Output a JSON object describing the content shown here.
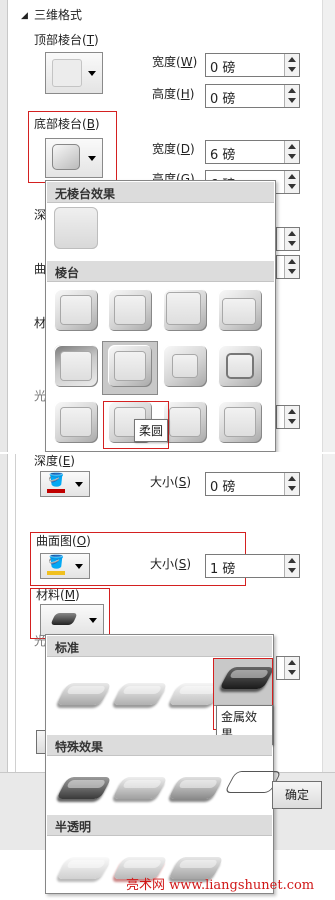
{
  "top": {
    "section_title": "三维格式",
    "bevel_top": {
      "label": "顶部棱台(",
      "key": "T",
      "close": ")"
    },
    "bevel_bottom": {
      "label": "底部棱台(",
      "key": "B",
      "close": ")"
    },
    "width1": {
      "label": "宽度(",
      "key": "W",
      "close": ")",
      "value": "0 磅"
    },
    "height1": {
      "label": "高度(",
      "key": "H",
      "close": ")",
      "value": "0 磅"
    },
    "width2": {
      "label": "宽度(",
      "key": "D",
      "close": ")",
      "value": "6 磅"
    },
    "height2": {
      "label": "高度(",
      "key": "G",
      "close": ")",
      "value": "6 磅"
    },
    "depth_partial": "深",
    "contour_partial": "曲",
    "material_partial": "材",
    "light_partial": "光",
    "bevel_popup": {
      "no_bevel_header": "无棱台效果",
      "bevel_header": "棱台",
      "tooltip": "柔圆"
    }
  },
  "bottom": {
    "depth": {
      "label": "深度(",
      "key": "E",
      "close": ")"
    },
    "depth_size": {
      "label": "大小(",
      "key": "S",
      "close": ")",
      "value": "0 磅"
    },
    "contour": {
      "label": "曲面图(",
      "key": "O",
      "close": ")"
    },
    "contour_size": {
      "label": "大小(",
      "key": "S",
      "close": ")",
      "value": "1 磅"
    },
    "material": {
      "label": "材料(",
      "key": "M",
      "close": ")"
    },
    "light_partial": "光",
    "material_popup": {
      "standard_header": "标准",
      "special_header": "特殊效果",
      "translucent_header": "半透明",
      "tooltip": "金属效果"
    },
    "ok_button": "确定",
    "watermark": "亮术网 www.liangshunet.com"
  },
  "colors": {
    "red_highlight": "#d42020",
    "depth_color": "#c00000",
    "contour_color": "#f0c020"
  }
}
